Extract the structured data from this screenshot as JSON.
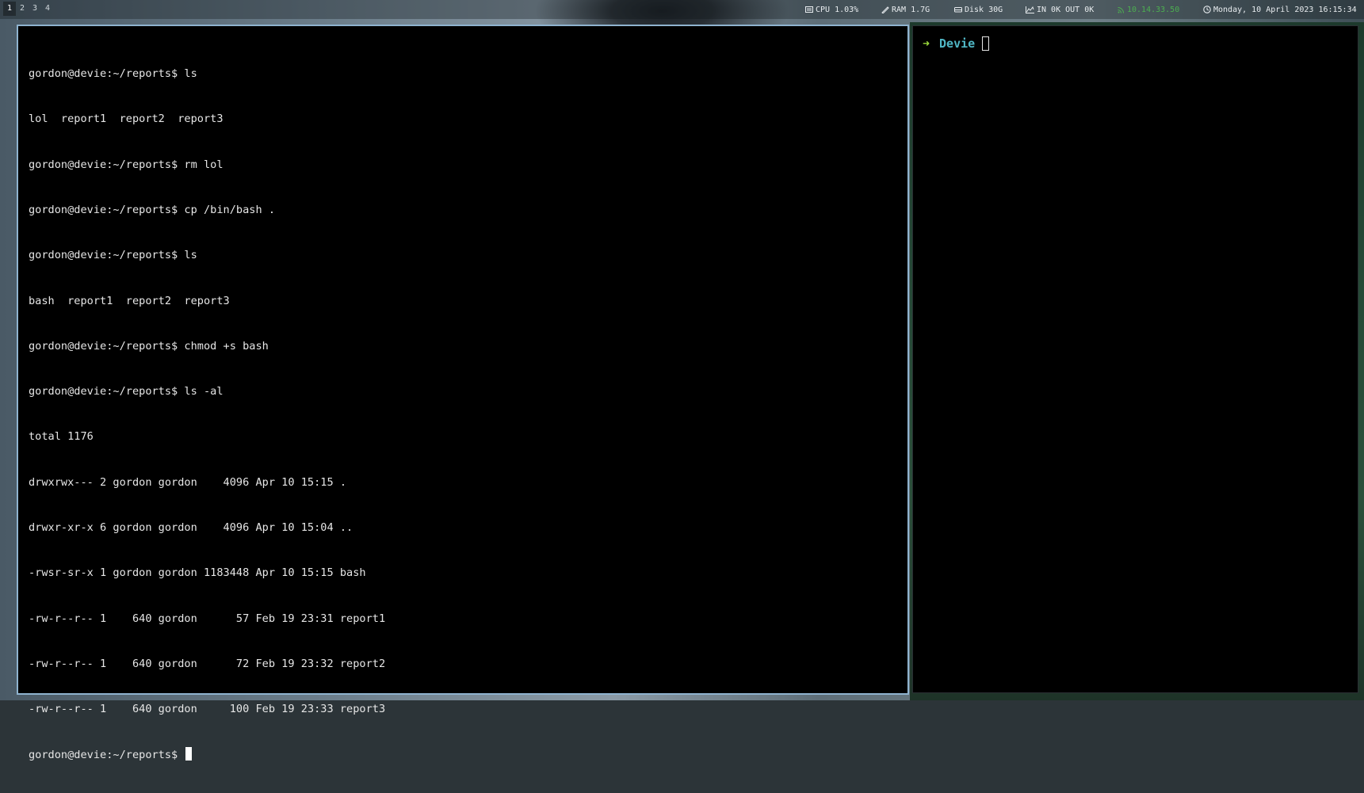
{
  "workspaces": [
    {
      "label": "1",
      "active": true
    },
    {
      "label": "2",
      "active": false
    },
    {
      "label": "3",
      "active": false
    },
    {
      "label": "4",
      "active": false
    }
  ],
  "status": {
    "cpu": "CPU 1.03%",
    "ram": "RAM 1.7G",
    "disk": "Disk 30G",
    "net": "IN 0K OUT 0K",
    "ip": "10.14.33.50",
    "datetime": "Monday, 10 April 2023 16:15:34"
  },
  "colors": {
    "focused_border": "#8fb3cf",
    "ip_green": "#4caf50",
    "prompt_arrow": "#9ad93c",
    "prompt_dir": "#4fb6c4",
    "terminal_bg": "#000000",
    "terminal_fg": "#e6e6e6"
  },
  "terminal_left": {
    "lines": [
      "gordon@devie:~/reports$ ls",
      "lol  report1  report2  report3",
      "gordon@devie:~/reports$ rm lol",
      "gordon@devie:~/reports$ cp /bin/bash .",
      "gordon@devie:~/reports$ ls",
      "bash  report1  report2  report3",
      "gordon@devie:~/reports$ chmod +s bash",
      "gordon@devie:~/reports$ ls -al",
      "total 1176",
      "drwxrwx--- 2 gordon gordon    4096 Apr 10 15:15 .",
      "drwxr-xr-x 6 gordon gordon    4096 Apr 10 15:04 ..",
      "-rwsr-sr-x 1 gordon gordon 1183448 Apr 10 15:15 bash",
      "-rw-r--r-- 1    640 gordon      57 Feb 19 23:31 report1",
      "-rw-r--r-- 1    640 gordon      72 Feb 19 23:32 report2",
      "-rw-r--r-- 1    640 gordon     100 Feb 19 23:33 report3"
    ],
    "current_prompt": "gordon@devie:~/reports$ "
  },
  "terminal_right": {
    "prompt_arrow": "➜",
    "prompt_dir": "Devie"
  }
}
